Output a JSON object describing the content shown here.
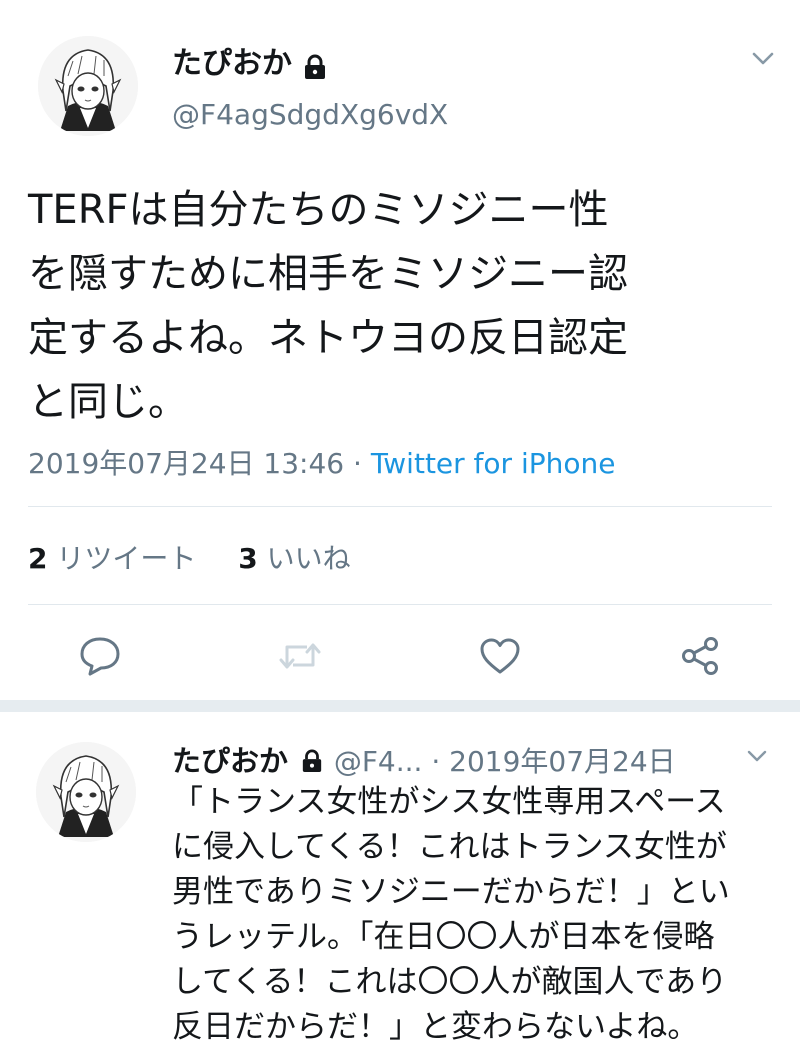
{
  "main_tweet": {
    "display_name": "たぴおか",
    "handle": "@F4agSdgdXg6vdX",
    "text_lines": [
      "TERFは自分たちのミソジニー性",
      "を隠すために相手をミソジニー認",
      "定するよね。ネトウヨの反日認定",
      "と同じ。"
    ],
    "timestamp": "2019年07月24日 13:46",
    "separator": " · ",
    "source": "Twitter for iPhone",
    "retweet_count": "2",
    "retweet_label": "リツイート",
    "like_count": "3",
    "like_label": "いいね",
    "icons": [
      "lock-icon",
      "chevron-down-icon",
      "reply-icon",
      "retweet-icon",
      "like-icon",
      "share-icon"
    ]
  },
  "reply_tweet": {
    "display_name": "たぴおか",
    "handle_truncated": "@F4...",
    "separator": " · ",
    "date": "2019年07月24日",
    "text_lines": [
      "「トランス女性がシス女性専用スペース",
      "に侵入してくる！これはトランス女性が",
      "男性でありミソジニーだからだ！」とい",
      "うレッテル。「在日〇〇人が日本を侵略",
      "してくる！これは〇〇人が敵国人であり",
      "反日だからだ！」と変わらないよね。"
    ]
  },
  "colors": {
    "text": "#14171a",
    "secondary": "#657786",
    "link": "#1b95e0",
    "divider": "#e1e8ed",
    "icon": "#657786",
    "retweet_disabled": "#ccd6dd"
  }
}
